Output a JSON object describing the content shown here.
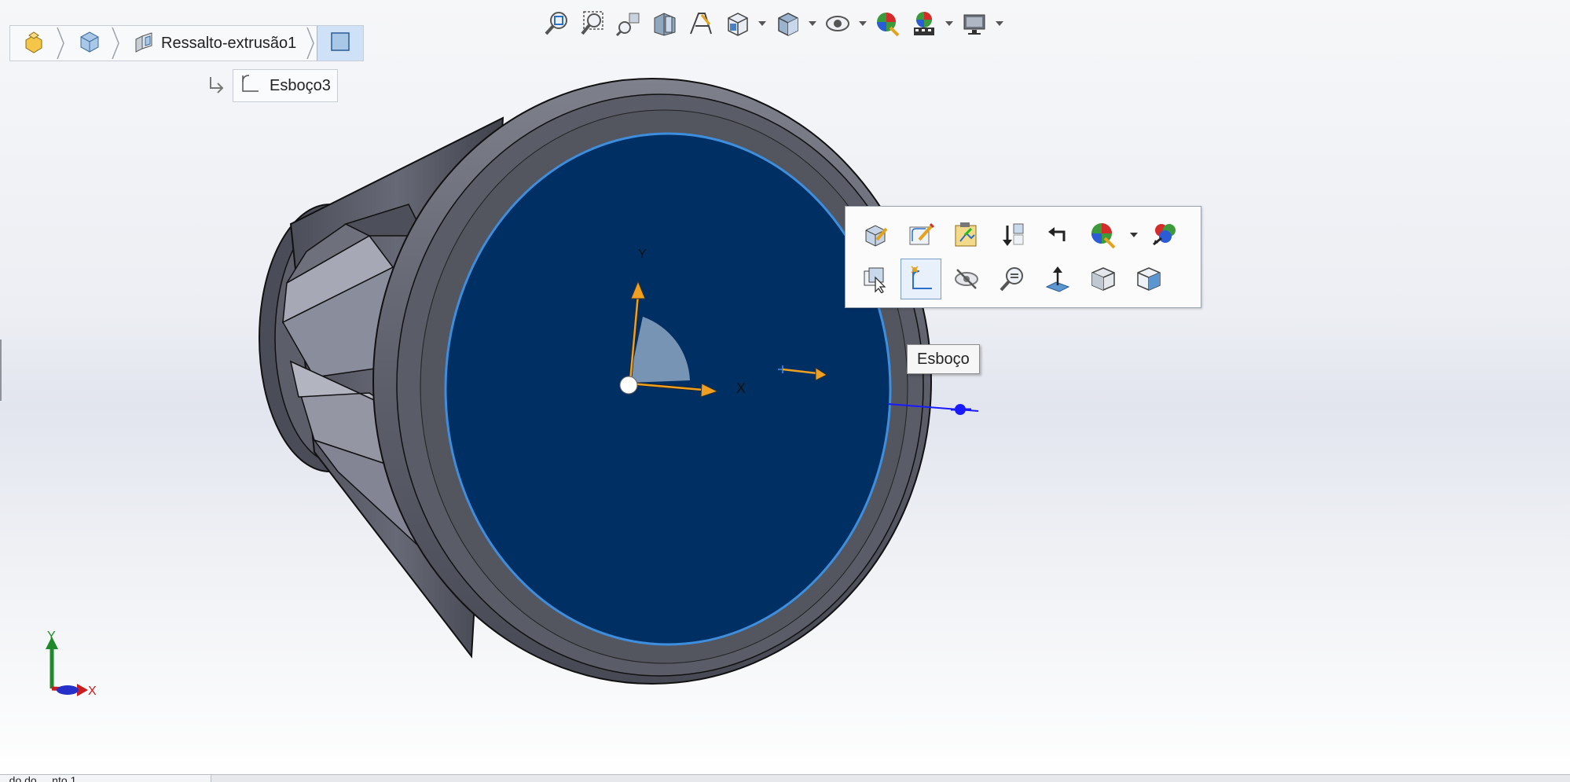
{
  "breadcrumb": {
    "items": [
      {
        "icon": "part-icon"
      },
      {
        "icon": "solid-body-icon"
      },
      {
        "icon": "boss-extrude-icon",
        "label": "Ressalto-extrusão1"
      },
      {
        "icon": "face-icon"
      }
    ],
    "sub_item": {
      "icon": "sketch-icon",
      "label": "Esboço3"
    }
  },
  "heads_up_toolbar": {
    "tools": [
      "zoom-to-fit-icon",
      "zoom-to-area-icon",
      "previous-view-icon",
      "section-view-icon",
      "dynamic-annotation-icon",
      "view-orientation-icon",
      "display-style-icon",
      "hide-show-items-icon",
      "edit-appearance-icon",
      "apply-scene-icon",
      "view-settings-icon"
    ]
  },
  "context_toolbar": {
    "row1": [
      "edit-feature-icon",
      "edit-sketch-icon",
      "sketch-on-face-icon",
      "rollback-icon",
      "parent-child-icon",
      "appearance-icon",
      "appearance-callout-icon"
    ],
    "row2": [
      "select-other-icon",
      "sketch-icon",
      "hide-icon",
      "zoom-to-selection-icon",
      "normal-to-icon",
      "view-isometric-icon",
      "view-front-icon"
    ]
  },
  "tooltip": {
    "text": "Esboço"
  },
  "sketch_axes": {
    "x_label": "X",
    "y_label": "Y"
  },
  "triad": {
    "x_label": "X",
    "y_label": "Y"
  },
  "statusbar": {
    "tab_label": "...do do ... nto 1"
  },
  "colors": {
    "face": "#002f63",
    "face_edge": "#3e8ede",
    "body": "#5a5c67",
    "axis_arrow": "#f0a020",
    "selection_blue": "#1a1aff"
  }
}
